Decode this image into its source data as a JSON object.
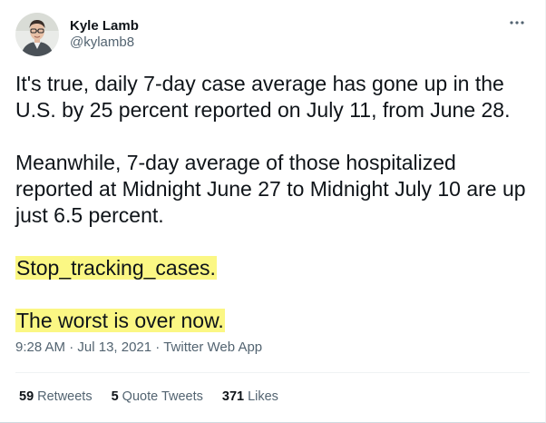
{
  "author": {
    "display_name": "Kyle Lamb",
    "handle": "@kylamb8"
  },
  "icons": {
    "more": "more-horizontal-icon",
    "avatar": "user-avatar"
  },
  "tweet": {
    "para1": "It's true, daily 7-day case average has gone up in the U.S. by 25 percent reported on July 11, from June 28.",
    "para2": "Meanwhile, 7-day average of those hospitalized reported at Midnight June 27 to Midnight July 10 are up just 6.5 percent.",
    "para3": "Stop_tracking_cases.",
    "para4": "The worst is over now.",
    "highlight_color": "#fbf784"
  },
  "meta": {
    "time": "9:28 AM",
    "sep1": " · ",
    "date": "Jul 13, 2021",
    "sep2": " · ",
    "source": "Twitter Web App"
  },
  "stats": {
    "retweets_count": "59",
    "retweets_label": "Retweets",
    "quotes_count": "5",
    "quotes_label": "Quote Tweets",
    "likes_count": "371",
    "likes_label": "Likes"
  },
  "colors": {
    "text": "#0f1419",
    "secondary": "#536471"
  }
}
